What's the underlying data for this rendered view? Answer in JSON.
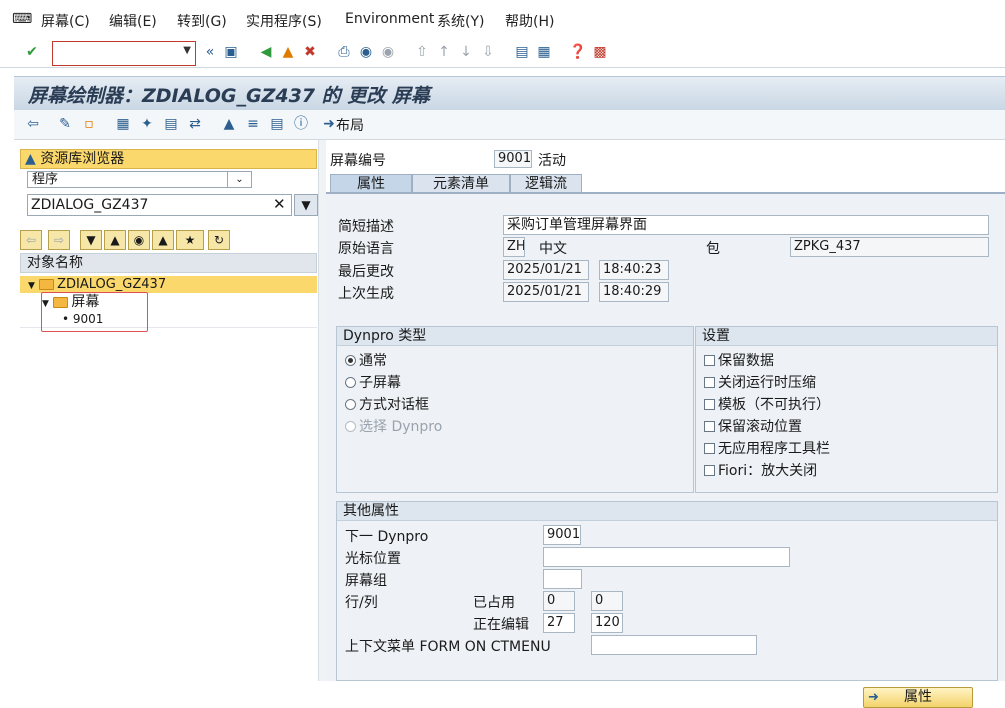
{
  "menu": [
    "屏幕(C)",
    "编辑(E)",
    "转到(G)",
    "实用程序(S)",
    "Environment",
    "系统(Y)",
    "帮助(H)"
  ],
  "command_field": {
    "value": ""
  },
  "title": "屏幕绘制器：ZDIALOG_GZ437 的 更改 屏幕",
  "app_toolbar": {
    "layout_label": "布局"
  },
  "left": {
    "repo_title": "资源库浏览器",
    "scope": "程序",
    "object_name": "ZDIALOG_GZ437",
    "tree_header": "对象名称",
    "tree": {
      "root": "ZDIALOG_GZ437",
      "folder": "屏幕",
      "leaf": "9001"
    }
  },
  "screen": {
    "number_label": "屏幕编号",
    "number": "9001",
    "status": "活动"
  },
  "tabs": [
    "属性",
    "元素清单",
    "逻辑流"
  ],
  "attributes": {
    "short_desc_label": "简短描述",
    "short_desc": "采购订单管理屏幕界面",
    "orig_lang_label": "原始语言",
    "orig_lang_code": "ZH",
    "orig_lang_name": "中文",
    "package_label": "包",
    "package": "ZPKG_437",
    "last_changed_label": "最后更改",
    "last_changed_date": "2025/01/21",
    "last_changed_time": "18:40:23",
    "last_gen_label": "上次生成",
    "last_gen_date": "2025/01/21",
    "last_gen_time": "18:40:29"
  },
  "dynpro_type": {
    "title": "Dynpro 类型",
    "options": [
      "通常",
      "子屏幕",
      "方式对话框",
      "选择 Dynpro"
    ],
    "selected": "通常"
  },
  "settings": {
    "title": "设置",
    "options": [
      "保留数据",
      "关闭运行时压缩",
      "模板（不可执行）",
      "保留滚动位置",
      "无应用程序工具栏",
      "Fiori：放大关闭"
    ]
  },
  "other": {
    "title": "其他属性",
    "next_dynpro_label": "下一 Dynpro",
    "next_dynpro": "9001",
    "cursor_label": "光标位置",
    "cursor": "",
    "screen_group_label": "屏幕组",
    "screen_group": "",
    "rowcol_label": "行/列",
    "used_label": "已占用",
    "used_row": "0",
    "used_col": "0",
    "editing_label": "正在编辑",
    "edit_row": "27",
    "edit_col": "120",
    "context_menu_label": "上下文菜单 FORM ON CTMENU",
    "context_menu": "",
    "attr_button": "属性"
  }
}
